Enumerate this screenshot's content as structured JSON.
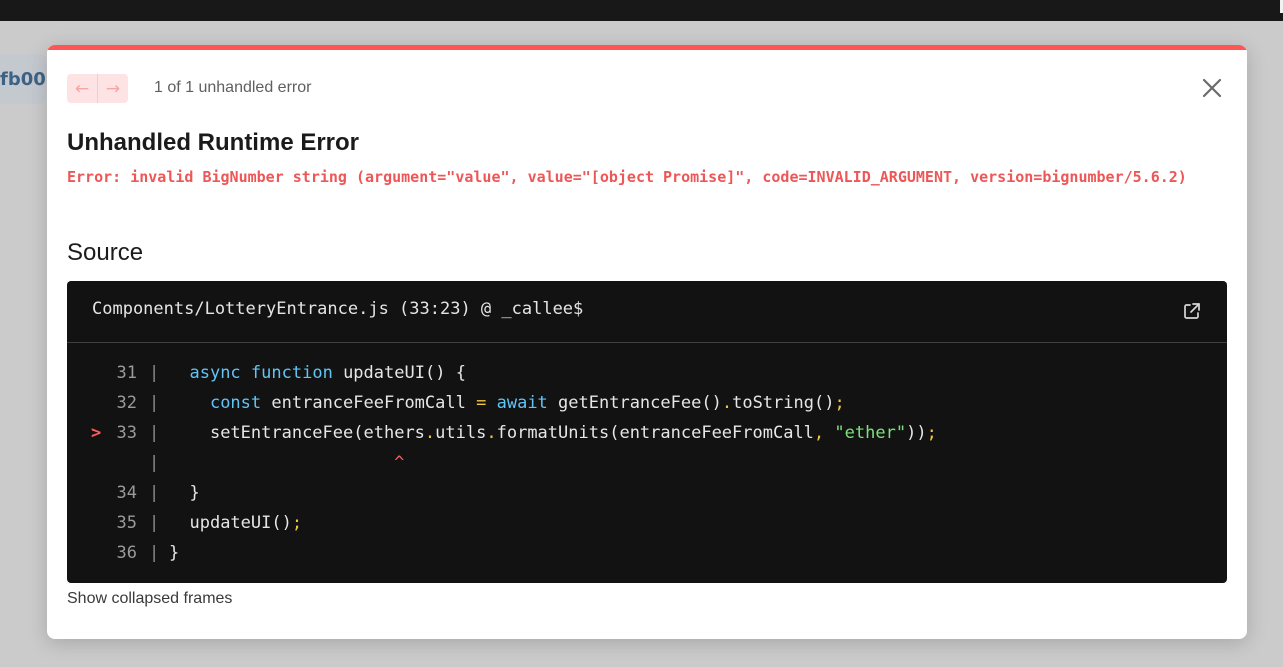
{
  "background": {
    "partial_text": "fb00"
  },
  "overlay": {
    "counter_text": "1 of 1 unhandled error",
    "prev_icon": "arrow-left-icon",
    "next_icon": "arrow-right-icon",
    "close_icon": "close-icon",
    "title": "Unhandled Runtime Error",
    "error_message": "Error: invalid BigNumber string (argument=\"value\", value=\"[object Promise]\", code=INVALID_ARGUMENT, version=bignumber/5.6.2)",
    "source_heading": "Source",
    "source": {
      "file_location": "Components/LotteryEntrance.js (33:23) @ _callee$",
      "external_icon": "external-link-icon",
      "lines": [
        {
          "marker": "",
          "num": "31",
          "pipe": "|",
          "code": "  async function updateUI() {"
        },
        {
          "marker": "",
          "num": "32",
          "pipe": "|",
          "code": "    const entranceFeeFromCall = await getEntranceFee().toString();"
        },
        {
          "marker": ">",
          "num": "33",
          "pipe": "|",
          "code": "    setEntranceFee(ethers.utils.formatUnits(entranceFeeFromCall, \"ether\"));"
        },
        {
          "marker": "",
          "num": "",
          "pipe": "|",
          "code": "                      ^"
        },
        {
          "marker": "",
          "num": "34",
          "pipe": "|",
          "code": "  }"
        },
        {
          "marker": "",
          "num": "35",
          "pipe": "|",
          "code": "  updateUI();"
        },
        {
          "marker": "",
          "num": "36",
          "pipe": "|",
          "code": "}"
        }
      ]
    },
    "show_collapsed_label": "Show collapsed frames"
  },
  "colors": {
    "accent": "#ff5555",
    "error_text": "#ee5757",
    "code_bg": "#121212",
    "keyword": "#62c3f5",
    "punctuation": "#f5c542",
    "string": "#7ce27c"
  }
}
